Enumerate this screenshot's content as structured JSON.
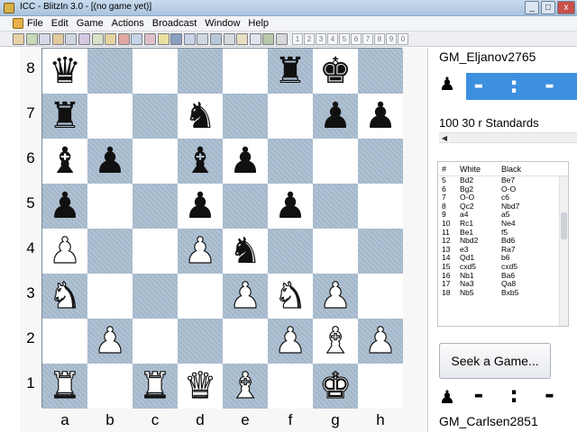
{
  "window": {
    "title": "ICC - BlitzIn 3.0 - [(no game yet)]",
    "controls": [
      "_",
      "□",
      "x"
    ]
  },
  "menu": [
    "File",
    "Edit",
    "Game",
    "Actions",
    "Broadcast",
    "Window",
    "Help"
  ],
  "toolbar": {
    "icons": [
      {
        "name": "tool-1-icon",
        "glyph": "",
        "color": "#e8d2a8"
      },
      {
        "name": "tool-2-icon",
        "glyph": "",
        "color": "#c7d9b7"
      },
      {
        "name": "tool-3-icon",
        "glyph": "",
        "color": "#d8d8e8"
      },
      {
        "name": "tool-4-icon",
        "glyph": "",
        "color": "#e3c8a0"
      },
      {
        "name": "tool-5-icon",
        "glyph": "",
        "color": "#cfd8e2"
      },
      {
        "name": "tool-6-icon",
        "glyph": "",
        "color": "#d6c7e0"
      },
      {
        "name": "tool-7-icon",
        "glyph": "",
        "color": "#d9e2c8"
      },
      {
        "name": "tool-8-icon",
        "glyph": "",
        "color": "#e6d2a0"
      },
      {
        "name": "tool-9-icon",
        "glyph": "",
        "color": "#e1a7a0"
      },
      {
        "name": "tool-10-icon",
        "glyph": "",
        "color": "#c8d3e8"
      },
      {
        "name": "tool-11-icon",
        "glyph": "",
        "color": "#e0c0c8"
      },
      {
        "name": "tool-12-icon",
        "glyph": "",
        "color": "#e9e0a0"
      },
      {
        "name": "tool-13-icon",
        "glyph": "",
        "color": "#8aa0c0"
      },
      {
        "name": "tool-14-icon",
        "glyph": "",
        "color": "#c8d3e8"
      },
      {
        "name": "tool-15-icon",
        "glyph": "",
        "color": "#d0d8e0"
      },
      {
        "name": "tool-16-icon",
        "glyph": "",
        "color": "#b8c8d8"
      },
      {
        "name": "tool-17-icon",
        "glyph": "",
        "color": "#d7dbe0"
      },
      {
        "name": "tool-18-icon",
        "glyph": "",
        "color": "#e8e0c0"
      },
      {
        "name": "tool-19-icon",
        "glyph": "",
        "color": "#dde5ee"
      },
      {
        "name": "tool-20-icon",
        "glyph": "",
        "color": "#b8c8a8"
      },
      {
        "name": "tool-21-icon",
        "glyph": "",
        "color": "#d8d8d8"
      }
    ],
    "numbers": [
      "1",
      "2",
      "3",
      "4",
      "5",
      "6",
      "7",
      "8",
      "9",
      "0"
    ]
  },
  "board": {
    "ranks": [
      "8",
      "7",
      "6",
      "5",
      "4",
      "3",
      "2",
      "1"
    ],
    "files": [
      "a",
      "b",
      "c",
      "d",
      "e",
      "f",
      "g",
      "h"
    ],
    "rows": [
      [
        {
          "p": "♛",
          "c": "black",
          "n": "black-queen-a8-icon"
        },
        null,
        null,
        null,
        null,
        {
          "p": "♜",
          "c": "black",
          "n": "black-rook-f8-icon"
        },
        {
          "p": "♚",
          "c": "black",
          "n": "black-king-g8-icon"
        },
        null
      ],
      [
        {
          "p": "♜",
          "c": "black",
          "n": "black-rook-a7-icon"
        },
        null,
        null,
        {
          "p": "♞",
          "c": "black",
          "n": "black-knight-d7-icon"
        },
        null,
        null,
        {
          "p": "♟",
          "c": "black",
          "n": "black-pawn-g7-icon"
        },
        {
          "p": "♟",
          "c": "black",
          "n": "black-pawn-h7-icon"
        }
      ],
      [
        {
          "p": "♝",
          "c": "black",
          "n": "black-bishop-a6-icon"
        },
        {
          "p": "♟",
          "c": "black",
          "n": "black-pawn-b6-icon"
        },
        null,
        {
          "p": "♝",
          "c": "black",
          "n": "black-bishop-d6-icon"
        },
        {
          "p": "♟",
          "c": "black",
          "n": "black-pawn-e6-icon"
        },
        null,
        null,
        null
      ],
      [
        {
          "p": "♟",
          "c": "black",
          "n": "black-pawn-a5-icon"
        },
        null,
        null,
        {
          "p": "♟",
          "c": "black",
          "n": "black-pawn-d5-icon"
        },
        null,
        {
          "p": "♟",
          "c": "black",
          "n": "black-pawn-f5-icon"
        },
        null,
        null
      ],
      [
        {
          "p": "♟",
          "c": "white",
          "n": "white-pawn-a4-icon"
        },
        null,
        null,
        {
          "p": "♟",
          "c": "white",
          "n": "white-pawn-d4-icon"
        },
        {
          "p": "♞",
          "c": "black",
          "n": "black-knight-e4-icon"
        },
        null,
        null,
        null
      ],
      [
        {
          "p": "♞",
          "c": "white",
          "n": "white-knight-a3-icon"
        },
        null,
        null,
        null,
        {
          "p": "♟",
          "c": "white",
          "n": "white-pawn-e3-icon"
        },
        {
          "p": "♞",
          "c": "white",
          "n": "white-knight-f3-icon"
        },
        {
          "p": "♟",
          "c": "white",
          "n": "white-pawn-g3-icon"
        },
        null
      ],
      [
        null,
        {
          "p": "♟",
          "c": "white",
          "n": "white-pawn-b2-icon"
        },
        null,
        null,
        null,
        {
          "p": "♟",
          "c": "white",
          "n": "white-pawn-f2-icon"
        },
        {
          "p": "♝",
          "c": "white",
          "n": "white-bishop-g2-icon"
        },
        {
          "p": "♟",
          "c": "white",
          "n": "white-pawn-h2-icon"
        }
      ],
      [
        {
          "p": "♜",
          "c": "white",
          "n": "white-rook-a1-icon"
        },
        null,
        {
          "p": "♜",
          "c": "white",
          "n": "white-rook-c1-icon"
        },
        {
          "p": "♛",
          "c": "white",
          "n": "white-queen-d1-icon"
        },
        {
          "p": "♝",
          "c": "white",
          "n": "white-bishop-e1-icon"
        },
        null,
        {
          "p": "♚",
          "c": "white",
          "n": "white-king-g1-icon"
        },
        null
      ]
    ]
  },
  "top_player": {
    "name": "GM_Eljanov",
    "rating": "2765",
    "clock": "- : - -",
    "icon": "pawn-icon"
  },
  "bottom_player": {
    "name": "GM_Carlsen",
    "rating": "2851",
    "clock": "- : - -",
    "icon": "pawn-icon"
  },
  "game_type": "100 30 r Standards",
  "moves": {
    "headers": {
      "num": "#",
      "white": "White",
      "black": "Black"
    },
    "rows": [
      {
        "num": "5",
        "white": "Bd2",
        "black": "Be7"
      },
      {
        "num": "6",
        "white": "Bg2",
        "black": "O-O"
      },
      {
        "num": "7",
        "white": "O-O",
        "black": "c6"
      },
      {
        "num": "8",
        "white": "Qc2",
        "black": "Nbd7"
      },
      {
        "num": "9",
        "white": "a4",
        "black": "a5"
      },
      {
        "num": "10",
        "white": "Rc1",
        "black": "Ne4"
      },
      {
        "num": "11",
        "white": "Be1",
        "black": "f5"
      },
      {
        "num": "12",
        "white": "Nbd2",
        "black": "Bd6"
      },
      {
        "num": "13",
        "white": "e3",
        "black": "Ra7"
      },
      {
        "num": "14",
        "white": "Qd1",
        "black": "b6"
      },
      {
        "num": "15",
        "white": "cxd5",
        "black": "cxd5"
      },
      {
        "num": "16",
        "white": "Nb1",
        "black": "Ba6"
      },
      {
        "num": "17",
        "white": "Na3",
        "black": "Qa8"
      },
      {
        "num": "18",
        "white": "Nb5",
        "black": "Bxb5"
      }
    ]
  },
  "seek_button": "Seek a Game...",
  "colors": {
    "clock_active_bg": "#3d8fe0",
    "dark_square": "#a9bdd0",
    "light_square": "#ffffff"
  }
}
